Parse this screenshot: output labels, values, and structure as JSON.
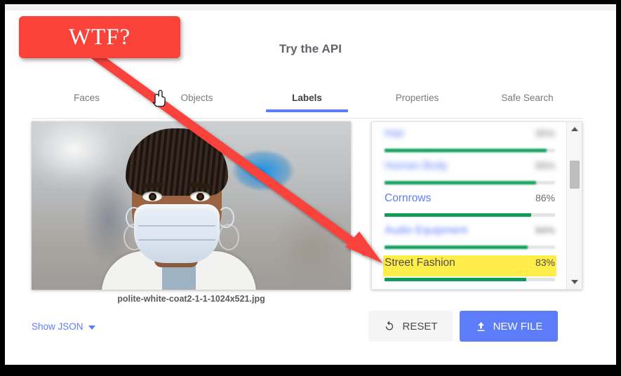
{
  "annotation": {
    "callout_text": "WTF?",
    "callout_color": "#f9423a"
  },
  "header": {
    "title": "Try the API"
  },
  "tabs": [
    {
      "label": "Faces",
      "active": false
    },
    {
      "label": "Objects",
      "active": false
    },
    {
      "label": "Labels",
      "active": true
    },
    {
      "label": "Properties",
      "active": false
    },
    {
      "label": "Safe Search",
      "active": false
    }
  ],
  "image": {
    "filename": "polite-white-coat2-1-1-1024x521.jpg",
    "alt": "woman with cornrow braids wearing a surgical mask and white coat"
  },
  "labels_panel": {
    "rows": [
      {
        "name": "Hair",
        "score": "95%",
        "percent": 95,
        "state": "blurred",
        "highlight": false
      },
      {
        "name": "Human Body",
        "score": "89%",
        "percent": 89,
        "state": "blurred",
        "highlight": false
      },
      {
        "name": "Cornrows",
        "score": "86%",
        "percent": 86,
        "state": "clear",
        "highlight": false
      },
      {
        "name": "Audio Equipment",
        "score": "84%",
        "percent": 84,
        "state": "blurred-soft",
        "highlight": false
      },
      {
        "name": "Street Fashion",
        "score": "83%",
        "percent": 83,
        "state": "clear",
        "highlight": true
      }
    ],
    "highlight_color": "#ffed4a",
    "bar_color": "#0f9d58"
  },
  "footer": {
    "show_json_label": "Show JSON",
    "reset_label": "RESET",
    "new_file_label": "NEW FILE",
    "accent_color": "#5c7cfa"
  }
}
